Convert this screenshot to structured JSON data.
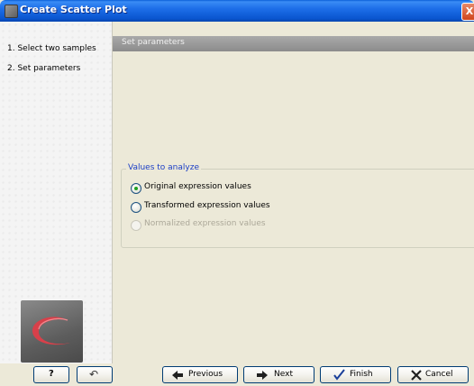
{
  "window": {
    "title": "Create Scatter Plot",
    "close_glyph": "X"
  },
  "steps": {
    "items": [
      {
        "label": "1. Select two samples"
      },
      {
        "label": "2. Set parameters"
      }
    ]
  },
  "main": {
    "section_header": "Set parameters",
    "group": {
      "title": "Values to analyze",
      "options": [
        {
          "label": "Original expression values",
          "checked": true,
          "disabled": false
        },
        {
          "label": "Transformed expression values",
          "checked": false,
          "disabled": false
        },
        {
          "label": "Normalized expression values",
          "checked": false,
          "disabled": true
        }
      ]
    }
  },
  "buttons": {
    "help_glyph": "?",
    "reset_glyph": "↶",
    "previous_label": "Previous",
    "next_label": "Next",
    "finish_label": "Finish",
    "cancel_label": "Cancel"
  },
  "colors": {
    "accent": "#1c3fc6",
    "title_bar": "#0a56d0",
    "close_button": "#d0451d",
    "radio_checked": "#21a121"
  },
  "icons": {
    "previous": "arrow-left-icon",
    "next": "arrow-right-icon",
    "finish": "checkmark-icon",
    "cancel": "x-icon",
    "logo": "clc-logo-icon"
  }
}
